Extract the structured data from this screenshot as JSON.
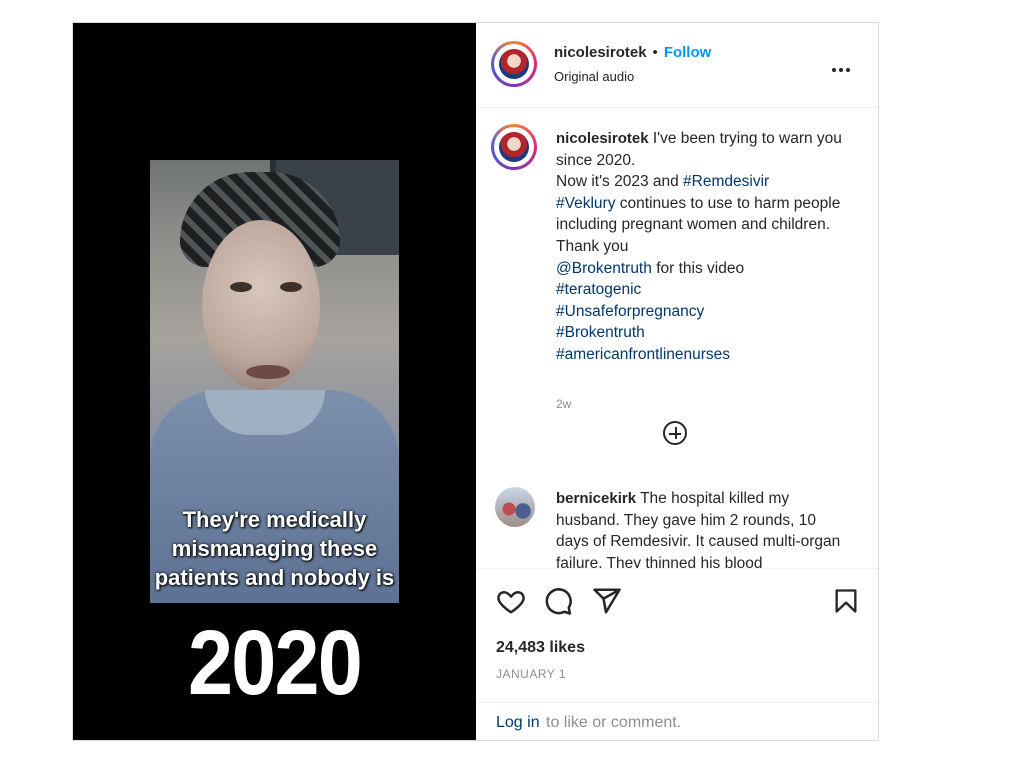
{
  "post": {
    "username": "nicolesirotek",
    "follow_label": "Follow",
    "separator": "•",
    "audio": "Original audio",
    "video": {
      "caption_lines": [
        "They're medically",
        "mismanaging these",
        "patients and nobody is"
      ],
      "year_overlay": "2020"
    },
    "caption": {
      "username": "nicolesirotek",
      "text_1": "I've been trying to warn you since 2020.",
      "text_2": "Now it's 2023 and",
      "tag_1": "#Remdesivir",
      "tag_2": "#Veklury",
      "text_3": "continues to use to harm people including pregnant women and children. Thank you",
      "mention": "@Brokentruth",
      "text_4": "for this video",
      "hashtags": [
        "#teratogenic",
        "#Unsafeforpregnancy",
        "#Brokentruth",
        "#americanfrontlinenurses"
      ],
      "time": "2w"
    },
    "comment": {
      "username": "bernicekirk",
      "text": "The hospital killed my husband. They gave him 2 rounds, 10 days of Remdesivir. It caused multi-organ failure. They thinned his blood"
    },
    "likes": "24,483 likes",
    "date": "JANUARY 1",
    "login_link": "Log in",
    "login_rest": "to like or comment."
  },
  "icons": [
    "more-icon",
    "heart-icon",
    "comment-icon",
    "share-icon",
    "bookmark-icon",
    "load-more-icon"
  ]
}
